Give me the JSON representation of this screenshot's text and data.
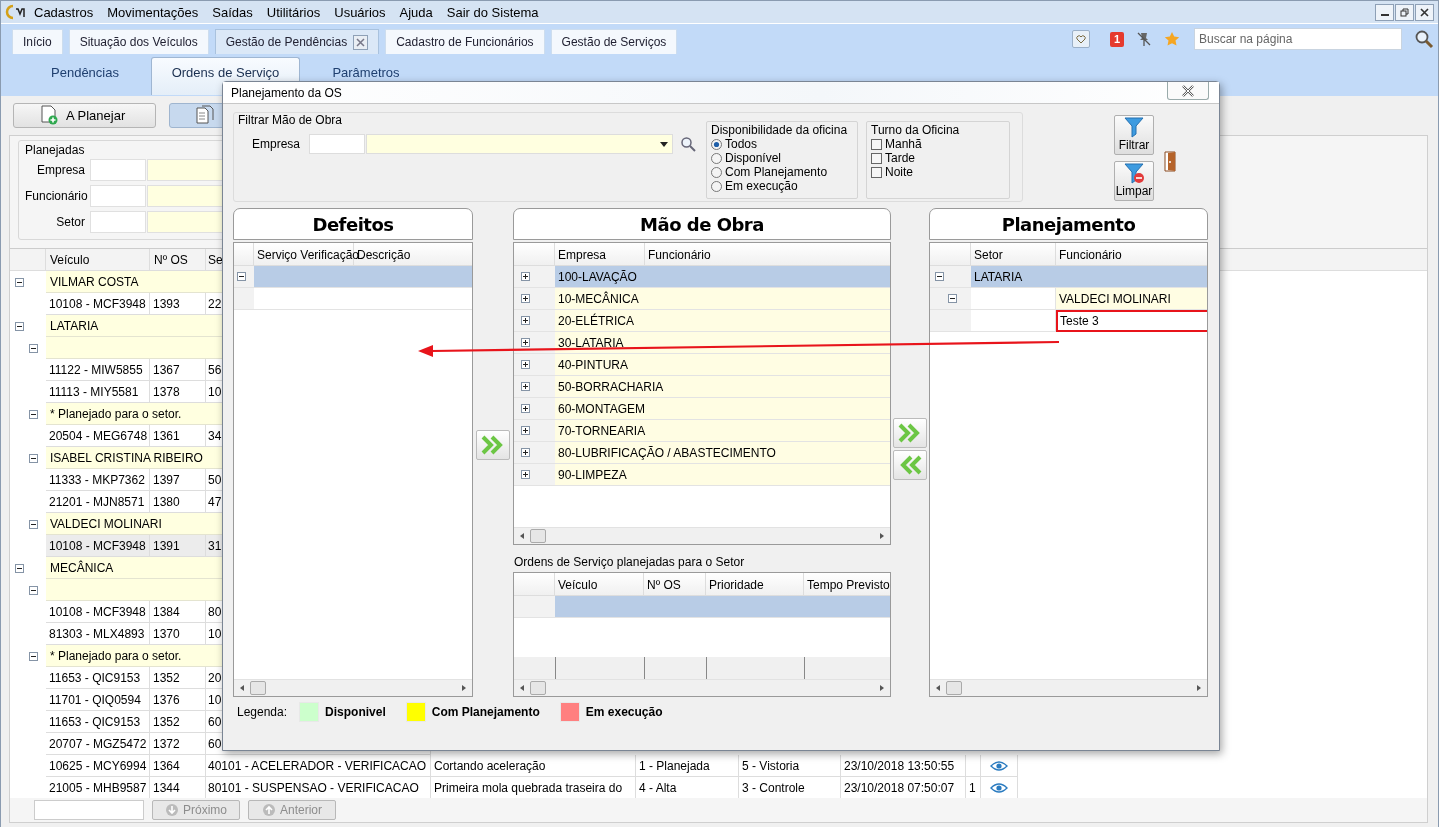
{
  "menu": {
    "items": [
      "Cadastros",
      "Movimentações",
      "Saídas",
      "Utilitários",
      "Usuários",
      "Ajuda",
      "Sair do Sistema"
    ]
  },
  "tabs": [
    {
      "label": "Início",
      "selected": false,
      "closable": false
    },
    {
      "label": "Situação dos Veículos",
      "selected": false,
      "closable": false
    },
    {
      "label": "Gestão de Pendências",
      "selected": true,
      "closable": true
    },
    {
      "label": "Cadastro de Funcionários",
      "selected": false,
      "closable": false
    },
    {
      "label": "Gestão de Serviços",
      "selected": false,
      "closable": false
    }
  ],
  "notifications": {
    "count": "1"
  },
  "page_search": {
    "placeholder": "Buscar na página"
  },
  "subtabs": [
    {
      "label": "Pendências",
      "selected": false
    },
    {
      "label": "Ordens de Serviço",
      "selected": true
    },
    {
      "label": "Parâmetros",
      "selected": false
    }
  ],
  "actions": [
    {
      "label": "A Planejar",
      "selected": false
    },
    {
      "selected": true
    }
  ],
  "filter": {
    "title": "Planejadas",
    "fields": [
      "Empresa",
      "Funcionário",
      "Setor"
    ]
  },
  "table": {
    "columns": [
      "Veículo",
      "Nº OS",
      "Se"
    ],
    "tree": [
      {
        "label": "VILMAR COSTA",
        "expanded": true,
        "children": [
          {
            "cells": [
              "10108 - MCF3948",
              "1393",
              "22"
            ],
            "selected": false
          }
        ]
      },
      {
        "label": "LATARIA",
        "expanded": true,
        "children": [
          {
            "expanded": true,
            "children": [
              {
                "cells": [
                  "11122 - MIW5855",
                  "1367",
                  "56"
                ],
                "selected": false
              },
              {
                "cells": [
                  "11113 - MIY5581",
                  "1378",
                  "10"
                ],
                "selected": false
              }
            ]
          },
          {
            "label": "* Planejado para o setor.",
            "expanded": true,
            "children": [
              {
                "cells": [
                  "20504 - MEG6748",
                  "1361",
                  "34"
                ],
                "selected": false
              }
            ]
          },
          {
            "label": "ISABEL CRISTINA RIBEIRO",
            "expanded": true,
            "children": [
              {
                "cells": [
                  "11333 - MKP7362",
                  "1397",
                  "50"
                ],
                "selected": false
              },
              {
                "cells": [
                  "21201 - MJN8571",
                  "1380",
                  "47"
                ],
                "selected": false
              }
            ]
          },
          {
            "label": "VALDECI MOLINARI",
            "expanded": true,
            "children": [
              {
                "cells": [
                  "10108 - MCF3948",
                  "1391",
                  "31"
                ],
                "selected": true
              }
            ]
          }
        ]
      },
      {
        "label": "MECÂNICA",
        "expanded": true,
        "children": [
          {
            "expanded": true,
            "children": [
              {
                "cells": [
                  "10108 - MCF3948",
                  "1384",
                  "80"
                ],
                "selected": false
              },
              {
                "cells": [
                  "81303 - MLX4893",
                  "1370",
                  "10"
                ],
                "selected": false
              }
            ]
          },
          {
            "label": "* Planejado para o setor.",
            "expanded": true,
            "children": [
              {
                "cells": [
                  "11653 - QIC9153",
                  "1352",
                  "20"
                ],
                "selected": false
              },
              {
                "cells": [
                  "11701 - QIQ0594",
                  "1376",
                  "10"
                ],
                "selected": false
              },
              {
                "cells": [
                  "11653 - QIC9153",
                  "1352",
                  "60"
                ],
                "selected": false
              },
              {
                "cells": [
                  "20707 - MGZ5472",
                  "1372",
                  "60"
                ],
                "selected": false
              },
              {
                "cells": [
                  "10625 - MCY6994",
                  "1364",
                  "40101 - ACELERADOR - VERIFICACAO",
                  "Cortando aceleração",
                  "1 - Planejada",
                  "5 - Vistoria",
                  "23/10/2018 13:50:55"
                ],
                "selected": false,
                "viewable": true
              },
              {
                "cells": [
                  "21005 - MHB9587",
                  "1344",
                  "80101 - SUSPENSAO - VERIFICACAO",
                  "Primeira mola quebrada traseira do",
                  "4 - Alta",
                  "3 - Controle",
                  "23/10/2018 07:50:07",
                  "1"
                ],
                "selected": false,
                "viewable": true
              }
            ]
          }
        ]
      }
    ]
  },
  "pager": {
    "buttons": [
      {
        "label": "Próximo",
        "disabled": true
      },
      {
        "label": "Anterior",
        "disabled": true
      }
    ]
  },
  "dialog": {
    "title": "Planejamento da OS",
    "filter": {
      "title": "Filtrar Mão de Obra",
      "label": "Empresa"
    },
    "availability": {
      "title": "Disponibilidade da oficina",
      "options": [
        {
          "label": "Todos",
          "selected": true
        },
        {
          "label": "Disponível",
          "selected": false
        },
        {
          "label": "Com Planejamento",
          "selected": false
        },
        {
          "label": "Em execução",
          "selected": false
        }
      ]
    },
    "shift": {
      "title": "Turno da Oficina",
      "options": [
        {
          "label": "Manhã",
          "checked": false
        },
        {
          "label": "Tarde",
          "checked": false
        },
        {
          "label": "Noite",
          "checked": false
        }
      ]
    },
    "buttons": [
      "Filtrar",
      "Limpar"
    ],
    "defects": {
      "title": "Defeitos",
      "columns": [
        "Serviço Verificação",
        "Descrição"
      ],
      "rows": [
        {
          "selected": true,
          "expanded": true,
          "children": [
            {
              "selected": false
            }
          ]
        }
      ]
    },
    "labor": {
      "title": "Mão de Obra",
      "columns": [
        "Empresa",
        "Funcionário"
      ],
      "items": [
        {
          "label": "100-LAVAÇÃO",
          "expanded": false,
          "selected": true
        },
        {
          "label": "10-MECÂNICA",
          "expanded": false,
          "selected": false
        },
        {
          "label": "20-ELÉTRICA",
          "expanded": false,
          "selected": false
        },
        {
          "label": "30-LATARIA",
          "expanded": false,
          "selected": false
        },
        {
          "label": "40-PINTURA",
          "expanded": false,
          "selected": false
        },
        {
          "label": "50-BORRACHARIA",
          "expanded": false,
          "selected": false
        },
        {
          "label": "60-MONTAGEM",
          "expanded": false,
          "selected": false
        },
        {
          "label": "70-TORNEARIA",
          "expanded": false,
          "selected": false
        },
        {
          "label": "80-LUBRIFICAÇÃO / ABASTECIMENTO",
          "expanded": false,
          "selected": false
        },
        {
          "label": "90-LIMPEZA",
          "expanded": false,
          "selected": false
        }
      ]
    },
    "orders": {
      "title": "Ordens de Serviço planejadas para o Setor",
      "columns": [
        "Veículo",
        "Nº OS",
        "Prioridade",
        "Tempo Previsto"
      ],
      "rows": [
        {
          "selected": true
        }
      ]
    },
    "planning": {
      "title": "Planejamento",
      "columns": [
        "Setor",
        "Funcionário"
      ],
      "tree": [
        {
          "sector": "LATARIA",
          "expanded": true,
          "selected": true,
          "children": [
            {
              "employee": "VALDECI MOLINARI",
              "expanded": true,
              "highlighted": false,
              "children": [
                {
                  "employee": "Teste 3",
                  "highlighted": true
                }
              ]
            }
          ]
        }
      ]
    },
    "legend": {
      "title": "Legenda:",
      "items": [
        {
          "label": "Disponivel",
          "color": "#ccffcc"
        },
        {
          "label": "Com Planejamento",
          "color": "#ffff00"
        },
        {
          "label": "Em execução",
          "color": "#ff8080"
        }
      ]
    }
  }
}
